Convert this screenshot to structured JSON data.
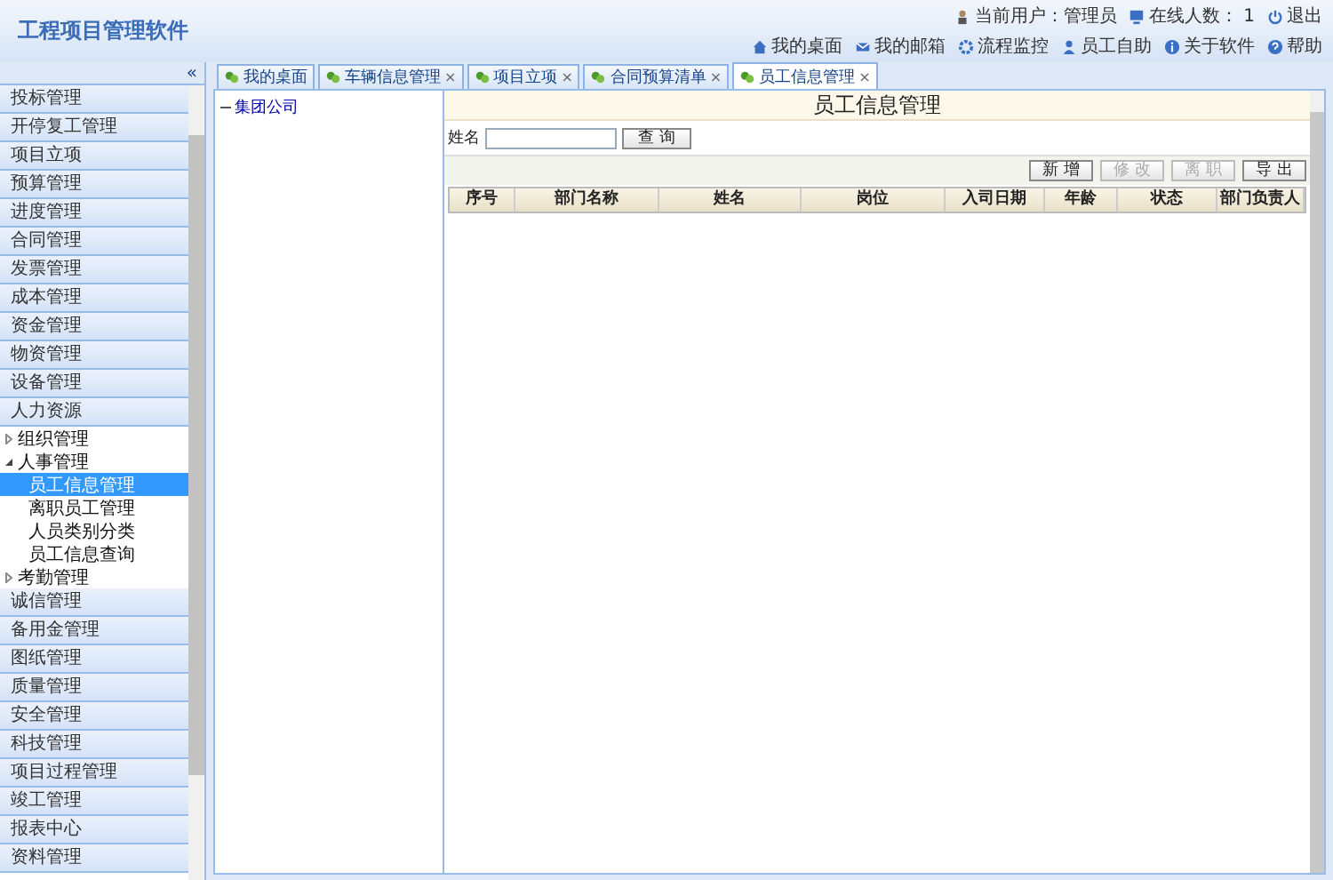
{
  "app_title": "工程项目管理软件",
  "header": {
    "user_label": "当前用户：",
    "user": "管理员",
    "online_label": "在线人数：",
    "online": "1",
    "logout": "退出",
    "links": [
      "我的桌面",
      "我的邮箱",
      "流程监控",
      "员工自助",
      "关于软件",
      "帮助"
    ]
  },
  "sidebar": {
    "collapse": "«",
    "sections": [
      {
        "label": "投标管理"
      },
      {
        "label": "开停复工管理"
      },
      {
        "label": "项目立项"
      },
      {
        "label": "预算管理"
      },
      {
        "label": "进度管理"
      },
      {
        "label": "合同管理"
      },
      {
        "label": "发票管理"
      },
      {
        "label": "成本管理"
      },
      {
        "label": "资金管理"
      },
      {
        "label": "物资管理"
      },
      {
        "label": "设备管理"
      },
      {
        "label": "人力资源",
        "children": [
          {
            "label": "组织管理",
            "expanded": false,
            "selected": false
          },
          {
            "label": "人事管理",
            "expanded": true,
            "selected": false,
            "children": [
              {
                "label": "员工信息管理",
                "selected": true
              },
              {
                "label": "离职员工管理",
                "selected": false
              },
              {
                "label": "人员类别分类",
                "selected": false
              },
              {
                "label": "员工信息查询",
                "selected": false
              }
            ]
          },
          {
            "label": "考勤管理",
            "expanded": false,
            "selected": false
          }
        ]
      },
      {
        "label": "诚信管理"
      },
      {
        "label": "备用金管理"
      },
      {
        "label": "图纸管理"
      },
      {
        "label": "质量管理"
      },
      {
        "label": "安全管理"
      },
      {
        "label": "科技管理"
      },
      {
        "label": "项目过程管理"
      },
      {
        "label": "竣工管理"
      },
      {
        "label": "报表中心"
      },
      {
        "label": "资料管理"
      }
    ]
  },
  "tabs": [
    {
      "label": "我的桌面",
      "closable": false,
      "selected": false
    },
    {
      "label": "车辆信息管理",
      "closable": true,
      "selected": false
    },
    {
      "label": "项目立项",
      "closable": true,
      "selected": false
    },
    {
      "label": "合同预算清单",
      "closable": true,
      "selected": false
    },
    {
      "label": "员工信息管理",
      "closable": true,
      "selected": true
    }
  ],
  "tab_close": "×",
  "org_tree": [
    "集团公司"
  ],
  "page_title": "员工信息管理",
  "search": {
    "label": "姓名",
    "button": "查 询"
  },
  "toolbar": [
    {
      "label": "新 增",
      "disabled": false
    },
    {
      "label": "修 改",
      "disabled": true
    },
    {
      "label": "离 职",
      "disabled": true
    },
    {
      "label": "导 出",
      "disabled": false
    }
  ],
  "table": {
    "columns": [
      "序号",
      "部门名称",
      "姓名",
      "岗位",
      "入司日期",
      "年龄",
      "状态",
      "部门负责人"
    ]
  }
}
